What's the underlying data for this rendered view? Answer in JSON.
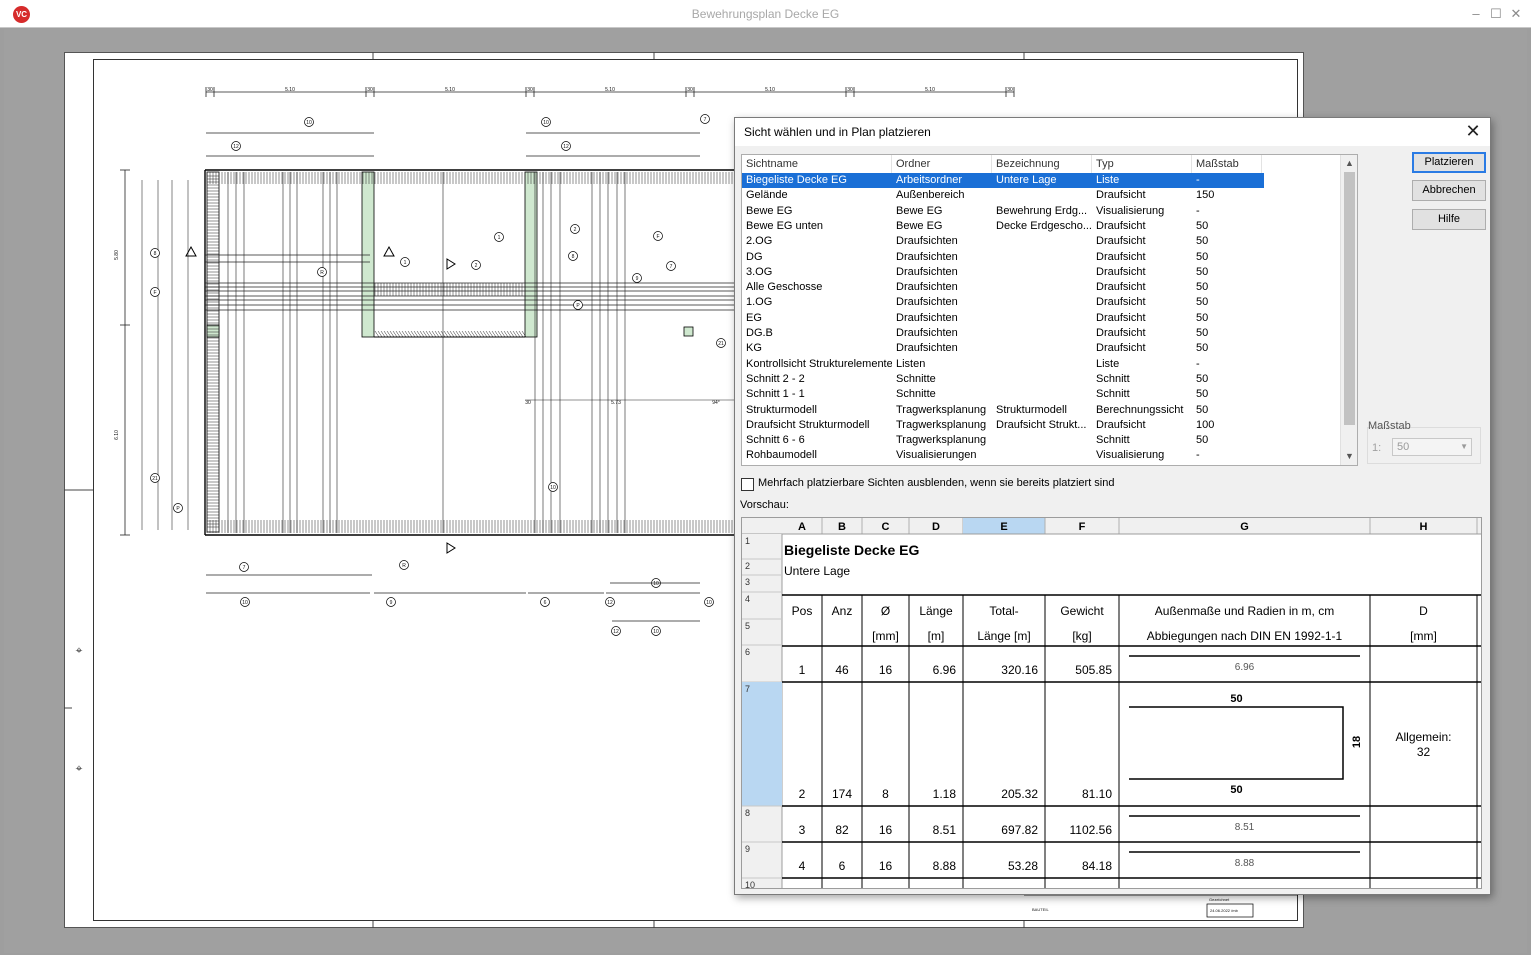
{
  "window": {
    "logo_text": "VC",
    "title": "Bewehrungsplan Decke EG",
    "minimize": "–",
    "maximize": "☐",
    "close": "✕"
  },
  "drawing": {
    "dims_top": [
      "30",
      "5.10",
      "30",
      "5.10",
      "30",
      "5.10",
      "30",
      "5.10",
      "30",
      "5.10",
      "30"
    ],
    "dims_left": [
      "5.80",
      "6.10"
    ],
    "bubbles": [
      "10",
      "12",
      "10",
      "12",
      "7",
      "R",
      "1",
      "2",
      "P",
      "21",
      "F",
      "8",
      "7",
      "9",
      "10",
      "10",
      "9",
      "6",
      "10"
    ],
    "title_block": {
      "bauteil": "BAUTEIL",
      "gezeichnet": "Gezeichnet",
      "datum": "24.06.2022 /mb"
    },
    "misc_labels": [
      "5.73",
      "94°",
      "30"
    ]
  },
  "dialog": {
    "title": "Sicht wählen und in Plan platzieren",
    "close_glyph": "✕",
    "columns": [
      "Sichtname",
      "Ordner",
      "Bezeichnung",
      "Typ",
      "Maßstab"
    ],
    "rows": [
      [
        "Biegeliste Decke EG",
        "Arbeitsordner",
        "Untere Lage",
        "Liste",
        "-"
      ],
      [
        "Gelände",
        "Außenbereich",
        "",
        "Draufsicht",
        "150"
      ],
      [
        "Bewe EG",
        "Bewe EG",
        "Bewehrung Erdg...",
        "Visualisierung",
        "-"
      ],
      [
        "Bewe EG unten",
        "Bewe EG",
        "Decke Erdgescho...",
        "Draufsicht",
        "50"
      ],
      [
        "2.OG",
        "Draufsichten",
        "",
        "Draufsicht",
        "50"
      ],
      [
        "DG",
        "Draufsichten",
        "",
        "Draufsicht",
        "50"
      ],
      [
        "3.OG",
        "Draufsichten",
        "",
        "Draufsicht",
        "50"
      ],
      [
        "Alle Geschosse",
        "Draufsichten",
        "",
        "Draufsicht",
        "50"
      ],
      [
        "1.OG",
        "Draufsichten",
        "",
        "Draufsicht",
        "50"
      ],
      [
        "EG",
        "Draufsichten",
        "",
        "Draufsicht",
        "50"
      ],
      [
        "DG.B",
        "Draufsichten",
        "",
        "Draufsicht",
        "50"
      ],
      [
        "KG",
        "Draufsichten",
        "",
        "Draufsicht",
        "50"
      ],
      [
        "Kontrollsicht Strukturelemente",
        "Listen",
        "",
        "Liste",
        "-"
      ],
      [
        "Schnitt 2 - 2",
        "Schnitte",
        "",
        "Schnitt",
        "50"
      ],
      [
        "Schnitt 1 - 1",
        "Schnitte",
        "",
        "Schnitt",
        "50"
      ],
      [
        "Strukturmodell",
        "Tragwerksplanung",
        "Strukturmodell",
        "Berechnungssicht",
        "50"
      ],
      [
        "Draufsicht Strukturmodell",
        "Tragwerksplanung",
        "Draufsicht Strukt...",
        "Draufsicht",
        "100"
      ],
      [
        "Schnitt 6 - 6",
        "Tragwerksplanung",
        "",
        "Schnitt",
        "50"
      ],
      [
        "Rohbaumodell",
        "Visualisierungen",
        "",
        "Visualisierung",
        "-"
      ]
    ],
    "selected_row": 0,
    "buttons": {
      "place": "Platzieren",
      "cancel": "Abbrechen",
      "help": "Hilfe"
    },
    "scale": {
      "label": "Maßstab",
      "prefix": "1:",
      "value": "50"
    },
    "checkbox_label": "Mehrfach platzierbare Sichten ausblenden, wenn sie bereits platziert sind",
    "checkbox_checked": false,
    "preview_label": "Vorschau:"
  },
  "preview": {
    "col_letters": [
      "A",
      "B",
      "C",
      "D",
      "E",
      "F",
      "G",
      "H"
    ],
    "selected_col": "E",
    "row_numbers": [
      "1",
      "2",
      "3",
      "4",
      "5",
      "6",
      "7",
      "8",
      "9",
      "10"
    ],
    "selected_row_number": "7",
    "doc_title": "Biegeliste Decke EG",
    "doc_subtitle": "Untere Lage",
    "headers_line1": [
      "Pos",
      "Anz",
      "Ø",
      "Länge",
      "Total-",
      "Gewicht",
      "Außenmaße und Radien in m, cm",
      "D"
    ],
    "headers_line2": [
      "",
      "",
      "[mm]",
      "[m]",
      "Länge [m]",
      "[kg]",
      "Abbiegungen nach DIN EN 1992-1-1",
      "[mm]"
    ],
    "data_rows": [
      {
        "pos": "1",
        "anz": "46",
        "dia": "16",
        "laenge": "6.96",
        "total": "320.16",
        "gewicht": "505.85",
        "shape": "straight",
        "shape_label": "6.96",
        "d": ""
      },
      {
        "pos": "2",
        "anz": "174",
        "dia": "8",
        "laenge": "1.18",
        "total": "205.32",
        "gewicht": "81.10",
        "shape": "bracket",
        "shape_top": "50",
        "shape_bottom": "50",
        "shape_side": "18",
        "d": "Allgemein:",
        "d2": "32"
      },
      {
        "pos": "3",
        "anz": "82",
        "dia": "16",
        "laenge": "8.51",
        "total": "697.82",
        "gewicht": "1102.56",
        "shape": "straight",
        "shape_label": "8.51",
        "d": ""
      },
      {
        "pos": "4",
        "anz": "6",
        "dia": "16",
        "laenge": "8.88",
        "total": "53.28",
        "gewicht": "84.18",
        "shape": "straight",
        "shape_label": "8.88",
        "d": ""
      }
    ]
  },
  "colors": {
    "selection": "#1a6fd6",
    "col_highlight": "#b9d7f2",
    "green_hatch": "#2e9a3a"
  }
}
